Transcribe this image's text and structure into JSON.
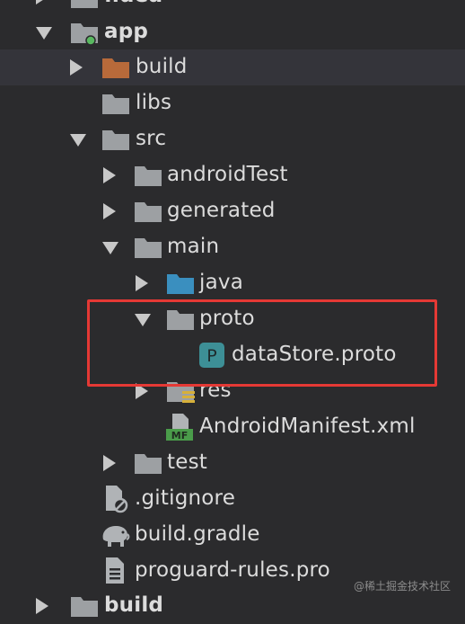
{
  "project_tree": {
    "rows": [
      {
        "name": ".idea"
      },
      {
        "name": "app"
      },
      {
        "name": "build"
      },
      {
        "name": "libs"
      },
      {
        "name": "src"
      },
      {
        "name": "androidTest"
      },
      {
        "name": "generated"
      },
      {
        "name": "main"
      },
      {
        "name": "java"
      },
      {
        "name": "proto"
      },
      {
        "name": "dataStore.proto"
      },
      {
        "name": "res"
      },
      {
        "name": "AndroidManifest.xml"
      },
      {
        "name": "test"
      },
      {
        "name": ".gitignore"
      },
      {
        "name": "build.gradle"
      },
      {
        "name": "proguard-rules.pro"
      },
      {
        "name": "build"
      }
    ]
  },
  "icons": {
    "folder": "folder-icon",
    "module_folder": "module-folder-icon",
    "build_folder": "excluded-folder-icon",
    "source_folder": "source-root-folder-icon",
    "resource_folder": "resource-folder-icon",
    "proto_file": "proto-file-icon",
    "manifest_file": "manifest-file-icon",
    "gitignore_file": "gitignore-file-icon",
    "gradle_file": "gradle-elephant-icon",
    "text_file": "text-file-icon"
  },
  "icon_glyphs": {
    "proto_letter": "P",
    "manifest_tag": "MF"
  },
  "colors": {
    "background": "#2b2b2d",
    "selected_row": "#34343a",
    "text": "#dcdcdc",
    "folder": "#9da0a3",
    "build_folder": "#b86a3a",
    "source_folder": "#3a8fbf",
    "proto_icon": "#3d8f96",
    "manifest_green": "#4a9c4a",
    "module_dot": "#59b860",
    "highlight": "#e53935"
  },
  "watermark": "@稀土掘金技术社区"
}
